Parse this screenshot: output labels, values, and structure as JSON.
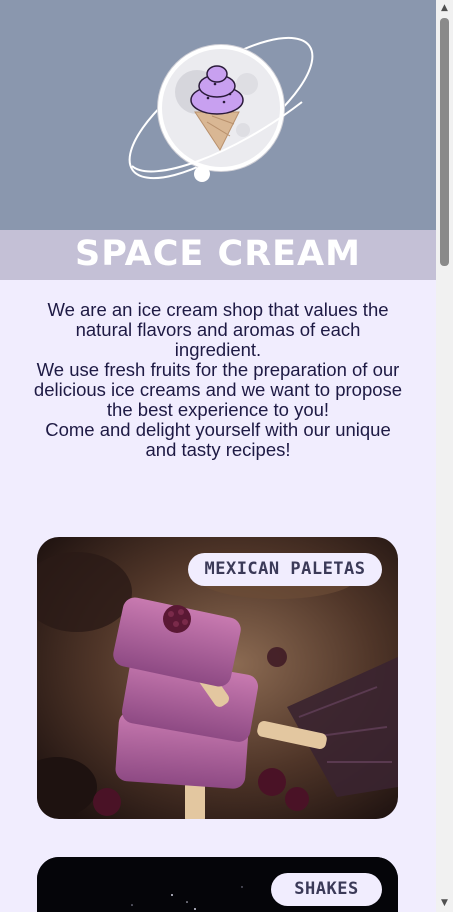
{
  "brand": {
    "title": "SPACE CREAM"
  },
  "about": {
    "paragraph_1": "We are an ice cream shop that values the natural flavors and aromas of each ingredient.",
    "paragraph_2": "We use fresh fruits for the preparation of our delicious ice creams and we want to propose the best experience to you!",
    "paragraph_3": "Come and delight yourself with our unique and tasty recipes!"
  },
  "products": [
    {
      "label": "MEXICAN PALETAS",
      "image": "purple-berry-ice-pops-photo"
    },
    {
      "label": "SHAKES",
      "image": "dark-starry-photo"
    }
  ],
  "colors": {
    "hero_bg": "#8a97ae",
    "title_band": "#c4c0d6",
    "page_bg": "#f1edfe",
    "text": "#1e1a44"
  }
}
